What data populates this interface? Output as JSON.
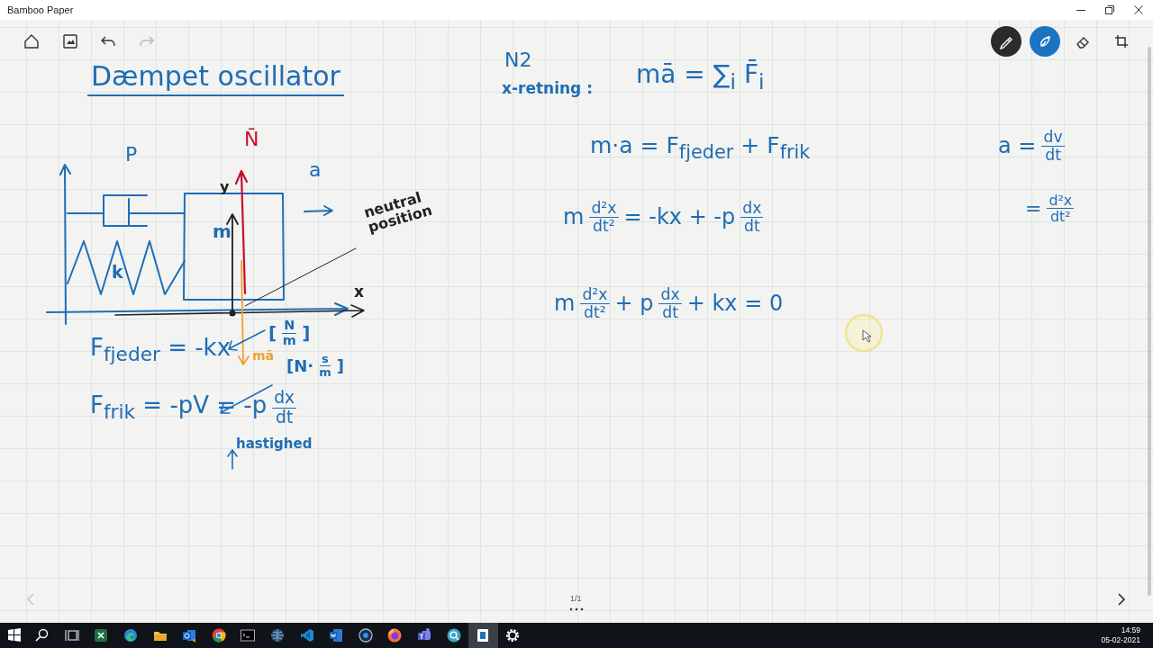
{
  "window": {
    "title": "Bamboo Paper"
  },
  "toolbar": {
    "left": [
      {
        "kind": "home",
        "disabled": false
      },
      {
        "kind": "image",
        "disabled": false
      },
      {
        "kind": "undo",
        "disabled": false
      },
      {
        "kind": "redo",
        "disabled": true
      }
    ],
    "right": [
      {
        "kind": "pen",
        "selected": true
      },
      {
        "kind": "ink",
        "selected": true
      },
      {
        "kind": "eraser",
        "selected": false
      },
      {
        "kind": "lasso",
        "selected": false
      }
    ]
  },
  "notes": [
    {
      "color": "#1f6db5",
      "parts": [
        {
          "text": "Dæmpet oscillator"
        }
      ]
    },
    {
      "color": "#c8102e",
      "parts": [
        {
          "text": "N̄"
        }
      ]
    },
    {
      "color": "#1f6db5",
      "parts": [
        {
          "text": "P"
        }
      ]
    },
    {
      "color": "#1f6db5",
      "parts": [
        {
          "text": "a"
        }
      ]
    },
    {
      "color": "#222222",
      "parts": [
        {
          "text": "y"
        }
      ]
    },
    {
      "color": "#222222",
      "parts": [
        {
          "text": "neutral position"
        }
      ]
    },
    {
      "color": "#1f6db5",
      "parts": [
        {
          "text": "m"
        }
      ]
    },
    {
      "color": "#1f6db5",
      "parts": [
        {
          "text": "k"
        }
      ]
    },
    {
      "color": "#222222",
      "parts": [
        {
          "text": "x"
        }
      ]
    },
    {
      "color": "#1f6db5",
      "parts": [
        {
          "text": "["
        },
        {
          "num": "N",
          "den": "m"
        },
        {
          "text": "]"
        }
      ]
    },
    {
      "color": "#f0a030",
      "parts": [
        {
          "text": "mā"
        }
      ]
    },
    {
      "color": "#1f6db5",
      "parts": [
        {
          "text": "F$_{fjeder}$ = -kx"
        }
      ]
    },
    {
      "color": "#1f6db5",
      "parts": [
        {
          "text": "[N·"
        },
        {
          "num": "s",
          "den": "m"
        },
        {
          "text": "]"
        }
      ]
    },
    {
      "color": "#1f6db5",
      "parts": [
        {
          "text": "F$_{frik}$ = -pV = -p"
        },
        {
          "num": "dx",
          "den": "dt"
        }
      ]
    },
    {
      "color": "#1f6db5",
      "parts": [
        {
          "text": "hastighed"
        }
      ]
    },
    {
      "color": "#1f6db5",
      "parts": [
        {
          "text": "N2"
        }
      ]
    },
    {
      "color": "#1f6db5",
      "parts": [
        {
          "text": "x-retning :"
        }
      ]
    },
    {
      "color": "#1f6db5",
      "parts": [
        {
          "text": "mā = ∑$_{i}$ F̄$_{i}$"
        }
      ]
    },
    {
      "color": "#1f6db5",
      "parts": [
        {
          "text": "m·a = F$_{fjeder}$ + F$_{frik}$"
        }
      ]
    },
    {
      "color": "#1f6db5",
      "parts": [
        {
          "text": "m"
        },
        {
          "num": "d²x",
          "den": "dt²"
        },
        {
          "text": "= -kx + -p"
        },
        {
          "num": "dx",
          "den": "dt"
        }
      ]
    },
    {
      "color": "#1f6db5",
      "parts": [
        {
          "text": "m"
        },
        {
          "num": "d²x",
          "den": "dt²"
        },
        {
          "text": "+ p"
        },
        {
          "num": "dx",
          "den": "dt"
        },
        {
          "text": "+ kx = 0"
        }
      ]
    },
    {
      "color": "#1f6db5",
      "parts": [
        {
          "text": "a ="
        },
        {
          "num": "dv",
          "den": "dt"
        }
      ]
    },
    {
      "color": "#1f6db5",
      "parts": [
        {
          "text": "="
        },
        {
          "num": "d²x",
          "den": "dt²"
        }
      ]
    }
  ],
  "pager": {
    "prev": {
      "disabled": true
    },
    "page": "1/1",
    "next": {
      "disabled": false
    }
  },
  "taskbar": {
    "apps": [
      {
        "kind": "spreadsheet",
        "selected": false
      },
      {
        "kind": "edge",
        "selected": false
      },
      {
        "kind": "folder",
        "selected": false
      },
      {
        "kind": "mail",
        "selected": false
      },
      {
        "kind": "chrome",
        "selected": false
      },
      {
        "kind": "terminal",
        "selected": false
      },
      {
        "kind": "globe",
        "selected": false
      },
      {
        "kind": "code",
        "selected": false
      },
      {
        "kind": "word",
        "selected": false
      },
      {
        "kind": "disc",
        "selected": false
      },
      {
        "kind": "firefox",
        "selected": false
      },
      {
        "kind": "teams",
        "selected": false
      },
      {
        "kind": "magnifier",
        "selected": false
      },
      {
        "kind": "bamboo",
        "selected": true
      },
      {
        "kind": "settings",
        "selected": false
      }
    ],
    "time": "14:59",
    "date": "05-02-2021"
  }
}
